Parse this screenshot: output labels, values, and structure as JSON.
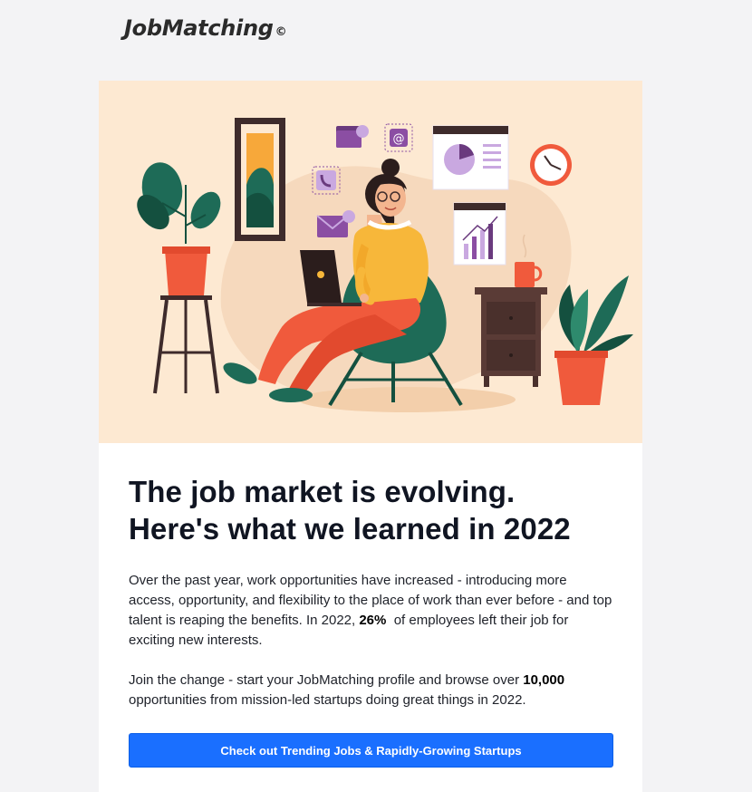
{
  "brand": {
    "name": "JobMatching",
    "mark": "©"
  },
  "hero": {
    "illustration": "woman-working-on-laptop-illustration"
  },
  "article": {
    "headline_line1": "The job market is evolving.",
    "headline_line2": "Here's what we learned in 2022",
    "p1_before": "Over the past year, work opportunities have increased - introducing more access, opportunity, and flexibility to the place of work than ever before - and top talent is reaping the benefits. In 2022, ",
    "p1_stat": "26%",
    "p1_after": "  of employees left their job for exciting new interests.",
    "p2_before": "Join the change - start your JobMatching profile and browse over ",
    "p2_stat": "10,000",
    "p2_after": " opportunities from mission-led startups doing great things in 2022."
  },
  "cta": {
    "label": "Check out Trending Jobs & Rapidly-Growing Startups"
  },
  "colors": {
    "background": "#f3f3f5",
    "hero_background": "#fde9d2",
    "button": "#1a6fff",
    "headline": "#101522"
  }
}
